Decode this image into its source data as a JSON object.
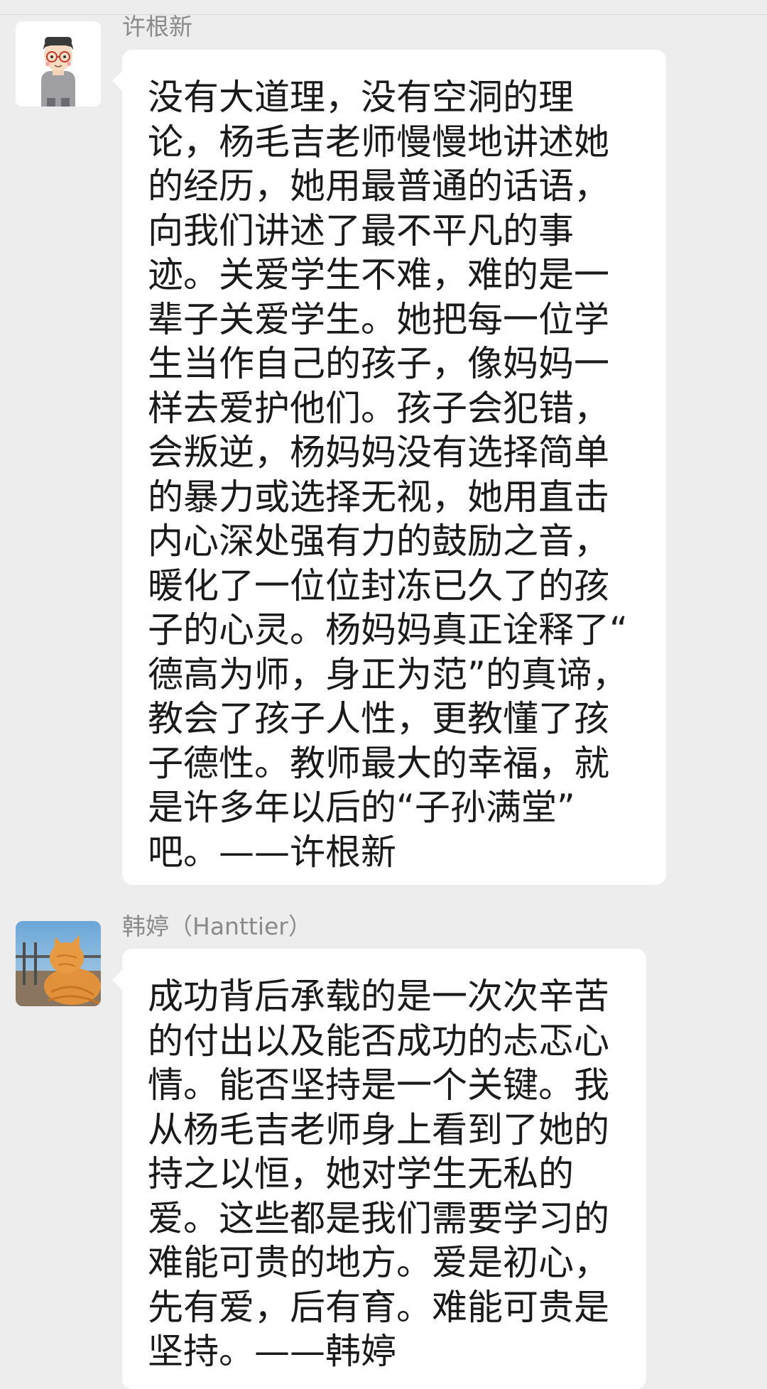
{
  "messages": [
    {
      "sender": "许根新",
      "avatar_icon": "cartoon-boy-with-glasses-avatar",
      "text": "没有大道理，没有空洞的理\n论，杨毛吉老师慢慢地讲述她\n的经历，她用最普通的话语，\n向我们讲述了最不平凡的事\n迹。关爱学生不难，难的是一\n辈子关爱学生。她把每一位学\n生当作自己的孩子，像妈妈一\n样去爱护他们。孩子会犯错，\n会叛逆，杨妈妈没有选择简单\n的暴力或选择无视，她用直击\n内心深处强有力的鼓励之音，\n暖化了一位位封冻已久了的孩\n子的心灵。杨妈妈真正诠释了“\n德高为师，身正为范”的真谛，\n教会了孩子人性，更教懂了孩\n子德性。教师最大的幸福，就\n是许多年以后的“子孙满堂”\n吧。——许根新"
    },
    {
      "sender": "韩婷（Hanttier）",
      "avatar_icon": "orange-cat-photo-avatar",
      "text": "成功背后承载的是一次次辛苦\n的付出以及能否成功的忐忑心\n情。能否坚持是一个关键。我\n从杨毛吉老师身上看到了她的\n持之以恒，她对学生无私的\n爱。这些都是我们需要学习的\n难能可贵的地方。爱是初心，\n先有爱，后有育。难能可贵是\n坚持。——韩婷"
    }
  ]
}
